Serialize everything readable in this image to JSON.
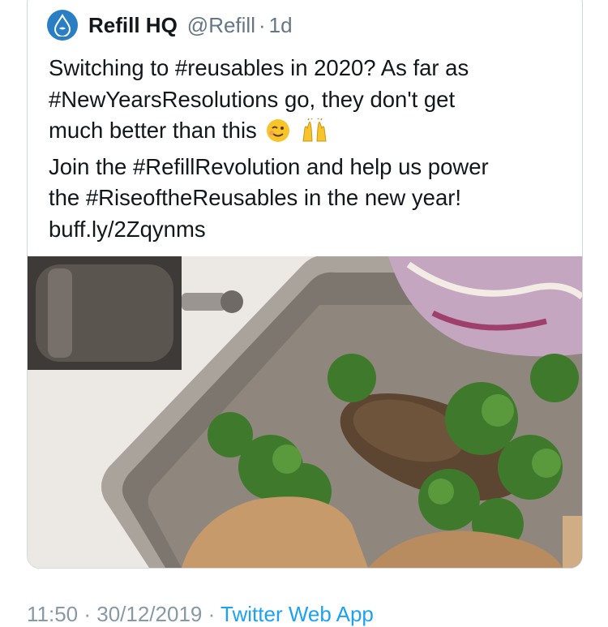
{
  "tweet": {
    "author_name": "Refill HQ",
    "handle": "@Refill",
    "separator": "·",
    "age": "1d",
    "text_line1": "Switching to #reusables in 2020? As far as",
    "text_line2": "#NewYearsResolutions go, they don't get",
    "text_line3": "much better than this",
    "text_line4": "Join the #RefillRevolution and help us power",
    "text_line5": "the #RiseoftheReusables in the new year!",
    "text_line6": "buff.ly/2Zqynms",
    "emojis": [
      "winking-face-emoji",
      "raising-hands-emoji"
    ],
    "media": {
      "description_icon": "photo",
      "alt": "Food served in a metal tray with parsley, coleslaw and a pepper grinder"
    }
  },
  "footer": {
    "timestamp": "11:50 · 30/12/2019",
    "separator": "·",
    "app": "Twitter Web App"
  },
  "colors": {
    "text": "#14171a",
    "secondary": "#657786",
    "accent": "#1da1f2",
    "avatar": "#2a7fc4",
    "border": "#cfd9de"
  }
}
